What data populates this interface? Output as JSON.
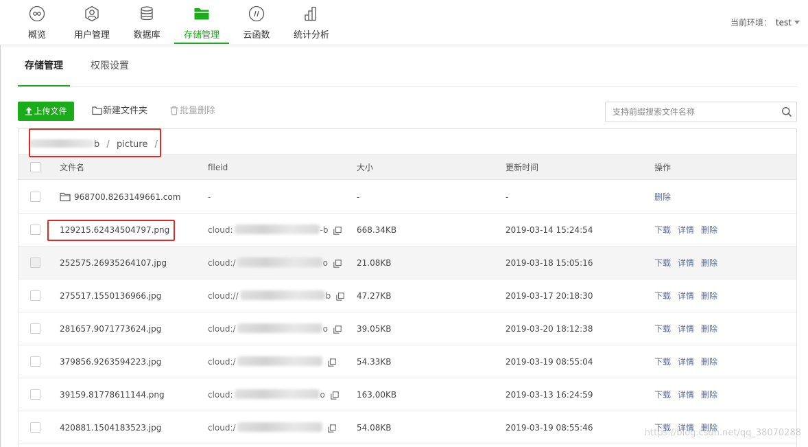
{
  "nav": {
    "items": [
      {
        "label": "概览",
        "icon": "overview-icon"
      },
      {
        "label": "用户管理",
        "icon": "user-icon"
      },
      {
        "label": "数据库",
        "icon": "database-icon"
      },
      {
        "label": "存储管理",
        "icon": "folder-icon",
        "active": true
      },
      {
        "label": "云函数",
        "icon": "cloud-function-icon"
      },
      {
        "label": "统计分析",
        "icon": "statistics-icon"
      }
    ],
    "env_label": "当前环境：",
    "env_value": "test",
    "accent": "#1aad19"
  },
  "subtabs": [
    {
      "label": "存储管理",
      "active": true
    },
    {
      "label": "权限设置"
    }
  ],
  "toolbar": {
    "upload_label": "上传文件",
    "new_folder_label": "新建文件夹",
    "batch_delete_label": "批量删除",
    "search_placeholder": "支持前缀搜索文件名称"
  },
  "breadcrumb": {
    "suffix": "b",
    "separator": "/",
    "folder": "picture"
  },
  "table": {
    "headers": {
      "name": "文件名",
      "fileid": "fileid",
      "size": "大小",
      "time": "更新时间",
      "ops": "操作"
    },
    "rows": [
      {
        "name": "968700.8263149661.com",
        "fileid": "-",
        "size": "-",
        "time": "-",
        "ops": [
          "删除"
        ],
        "folder": true
      },
      {
        "name": "129215.62434504797.png",
        "fileid_prefix": "cloud:",
        "fileid_suffix": "-b",
        "size": "668.34KB",
        "time": "2019-03-14 15:24:54",
        "ops": [
          "下载",
          "详情",
          "删除"
        ]
      },
      {
        "name": "252575.26935264107.jpg",
        "fileid_prefix": "cloud:/",
        "fileid_suffix": "o",
        "size": "21.08KB",
        "time": "2019-03-18 15:05:16",
        "ops": [
          "下载",
          "详情",
          "删除"
        ]
      },
      {
        "name": "275517.1550136966.jpg",
        "fileid_prefix": "cloud://",
        "fileid_suffix": "b",
        "size": "47.27KB",
        "time": "2019-03-17 20:18:30",
        "ops": [
          "下载",
          "详情",
          "删除"
        ]
      },
      {
        "name": "281657.9071773624.jpg",
        "fileid_prefix": "cloud:/",
        "fileid_suffix": "o",
        "size": "39.05KB",
        "time": "2019-03-20 18:12:38",
        "ops": [
          "下载",
          "详情",
          "删除"
        ]
      },
      {
        "name": "379856.9263594223.jpg",
        "fileid_prefix": "cloud:/",
        "fileid_suffix": "",
        "size": "54.33KB",
        "time": "2019-03-19 08:55:04",
        "ops": [
          "下载",
          "详情",
          "删除"
        ]
      },
      {
        "name": "39159.81778611144.png",
        "fileid_prefix": "cloud:",
        "fileid_suffix": "o",
        "size": "163.00KB",
        "time": "2019-03-13 16:24:59",
        "ops": [
          "下载",
          "详情",
          "删除"
        ]
      },
      {
        "name": "420881.1504183523.jpg",
        "fileid_prefix": "cloud:/",
        "fileid_suffix": "",
        "size": "54.08KB",
        "time": "2019-03-19 08:55:46",
        "ops": [
          "下载",
          "详情",
          "删除"
        ]
      }
    ]
  },
  "watermark": "https://blog.csdn.net/qq_38070288",
  "annotation_color": "#e0281f"
}
